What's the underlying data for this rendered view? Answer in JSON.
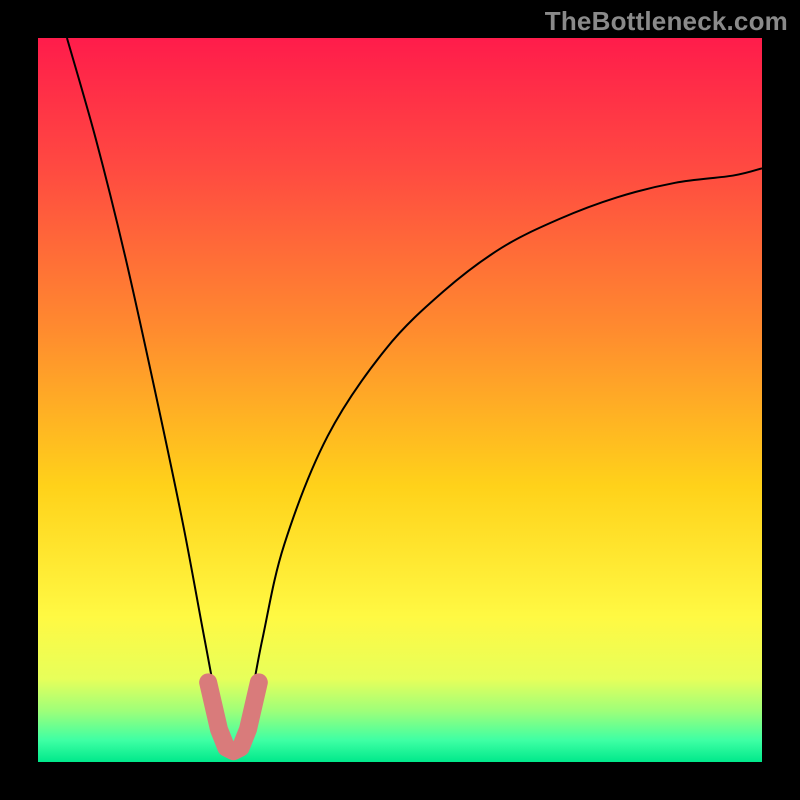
{
  "watermark": "TheBottleneck.com",
  "chart_data": {
    "type": "line",
    "title": "",
    "xlabel": "",
    "ylabel": "",
    "xlim": [
      0,
      1
    ],
    "ylim": [
      0,
      1
    ],
    "x_min_point": 0.27,
    "series": [
      {
        "name": "curve",
        "comment": "V-shaped valley centered near x≈0.27; values are y as fraction of plot height (0=bottom,1=top), estimated from pixels.",
        "x": [
          0.04,
          0.08,
          0.12,
          0.16,
          0.2,
          0.23,
          0.25,
          0.27,
          0.29,
          0.31,
          0.34,
          0.4,
          0.48,
          0.56,
          0.64,
          0.72,
          0.8,
          0.88,
          0.96,
          1.0
        ],
        "y": [
          1.0,
          0.86,
          0.7,
          0.52,
          0.33,
          0.17,
          0.07,
          0.02,
          0.07,
          0.17,
          0.3,
          0.45,
          0.57,
          0.65,
          0.71,
          0.75,
          0.78,
          0.8,
          0.81,
          0.82
        ]
      }
    ],
    "highlight": {
      "comment": "thick salmon overlay around the minimum",
      "x": [
        0.235,
        0.25,
        0.26,
        0.27,
        0.28,
        0.29,
        0.305
      ],
      "y": [
        0.11,
        0.045,
        0.02,
        0.015,
        0.02,
        0.045,
        0.11
      ],
      "color": "#d97b7b"
    },
    "gradient_stops": [
      {
        "offset": 0.0,
        "color": "#ff1c4b"
      },
      {
        "offset": 0.18,
        "color": "#ff4a41"
      },
      {
        "offset": 0.4,
        "color": "#ff8a2f"
      },
      {
        "offset": 0.62,
        "color": "#ffd21a"
      },
      {
        "offset": 0.8,
        "color": "#fff943"
      },
      {
        "offset": 0.885,
        "color": "#e7ff5a"
      },
      {
        "offset": 0.93,
        "color": "#9dff7a"
      },
      {
        "offset": 0.97,
        "color": "#3effa4"
      },
      {
        "offset": 1.0,
        "color": "#00e98b"
      }
    ]
  }
}
